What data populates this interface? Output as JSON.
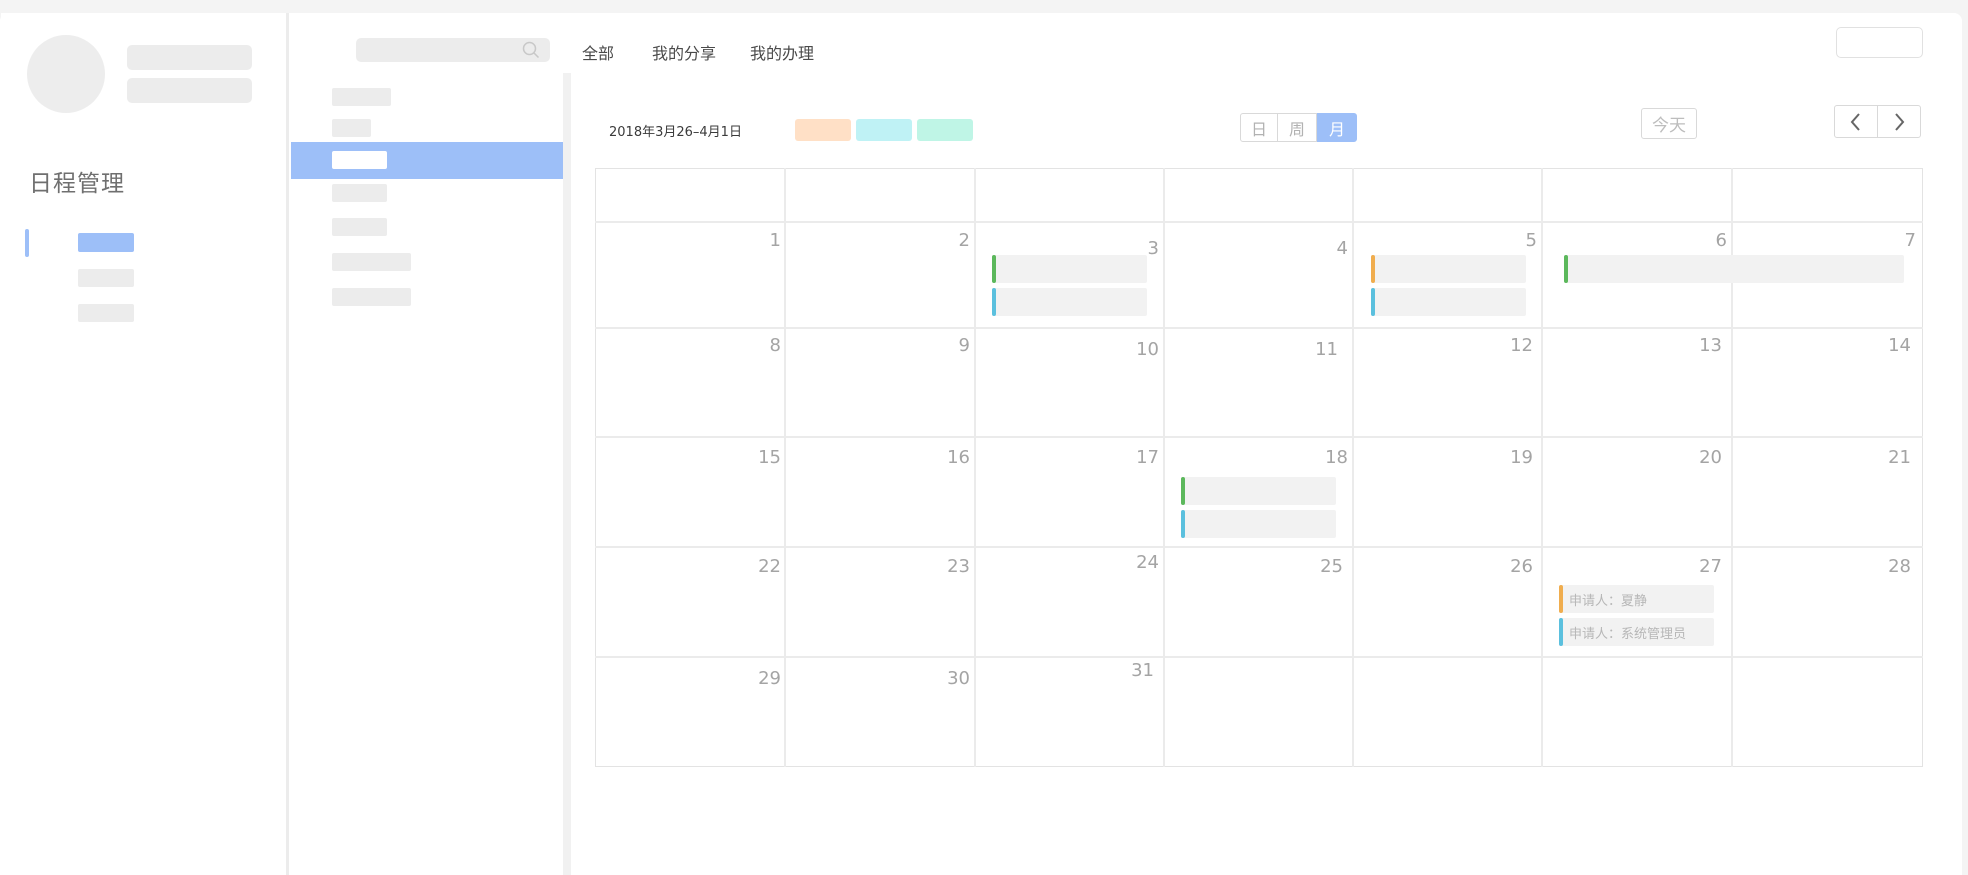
{
  "sidebar": {
    "title": "日程管理"
  },
  "header": {
    "tabs": [
      {
        "label": "全部"
      },
      {
        "label": "我的分享"
      },
      {
        "label": "我的办理"
      }
    ]
  },
  "calendar": {
    "date_range": "2018年3月26–4月1日",
    "view_buttons": [
      {
        "label": "日",
        "active": false
      },
      {
        "label": "周",
        "active": false
      },
      {
        "label": "月",
        "active": true
      }
    ],
    "today_label": "今天",
    "legend_colors": [
      "#ffe0c6",
      "#bff2f5",
      "#bff5e6"
    ],
    "event_colors": {
      "green": "#5cb85c",
      "orange": "#f0ad4e",
      "blue": "#5bc0de"
    },
    "weeks": [
      [
        "1",
        "2",
        "3",
        "4",
        "5",
        "6",
        "7"
      ],
      [
        "8",
        "9",
        "10",
        "11",
        "12",
        "13",
        "14"
      ],
      [
        "15",
        "16",
        "17",
        "18",
        "19",
        "20",
        "21"
      ],
      [
        "22",
        "23",
        "24",
        "25",
        "26",
        "27",
        "28"
      ],
      [
        "29",
        "30",
        "31",
        "",
        "",
        "",
        ""
      ]
    ],
    "labeled_events": [
      {
        "text": "申请人：夏静",
        "color": "orange"
      },
      {
        "text": "申请人：系统管理员",
        "color": "blue"
      }
    ]
  }
}
